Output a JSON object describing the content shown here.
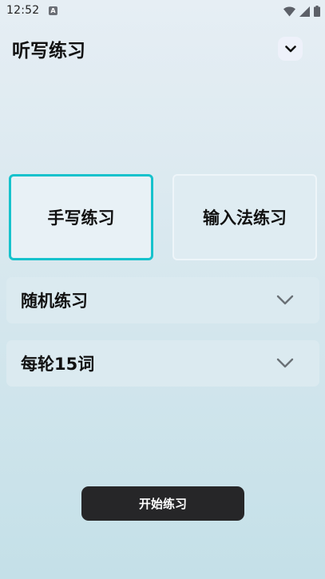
{
  "status_bar": {
    "time": "12:52",
    "notification_icon": "A",
    "icons": [
      "wifi-icon",
      "signal-icon",
      "battery-icon"
    ]
  },
  "header": {
    "title": "听写练习",
    "toggle_icon": "chevron-down-icon"
  },
  "modes": [
    {
      "label": "手写练习",
      "selected": true
    },
    {
      "label": "输入法练习",
      "selected": false
    }
  ],
  "options": {
    "order": {
      "value": "随机练习",
      "icon": "chevron-down-icon"
    },
    "count": {
      "value": "每轮15词",
      "icon": "chevron-down-icon"
    }
  },
  "start_button": {
    "label": "开始练习"
  },
  "colors": {
    "selected_border": "#16c2cc",
    "button_bg": "#262628",
    "button_text": "#ffffff",
    "header_toggle_bg": "#eef1fa"
  }
}
